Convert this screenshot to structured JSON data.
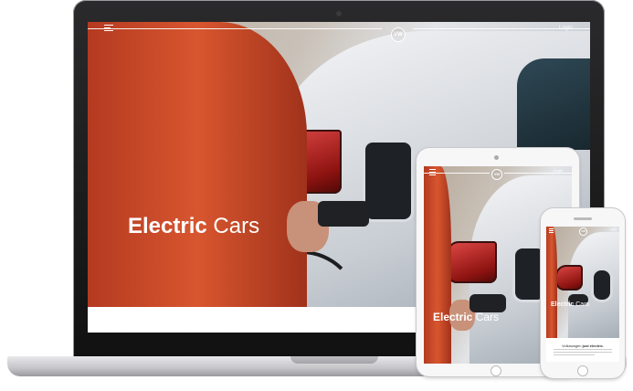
{
  "site": {
    "brand_logo": "VW",
    "login_label": "Login",
    "hero_title_bold": "Electric",
    "hero_title_light": "Cars",
    "phone_tagline_prefix": "Volkswagen",
    "phone_tagline_bold": "just electric."
  },
  "icons": {
    "menu": "hamburger-menu-icon",
    "logo": "vw-logo-icon"
  },
  "colors": {
    "hero_sleeve": "#d8562f",
    "taillight": "#c0201d",
    "device_frame": "#2a2a2c",
    "text_on_hero": "#ffffff"
  }
}
